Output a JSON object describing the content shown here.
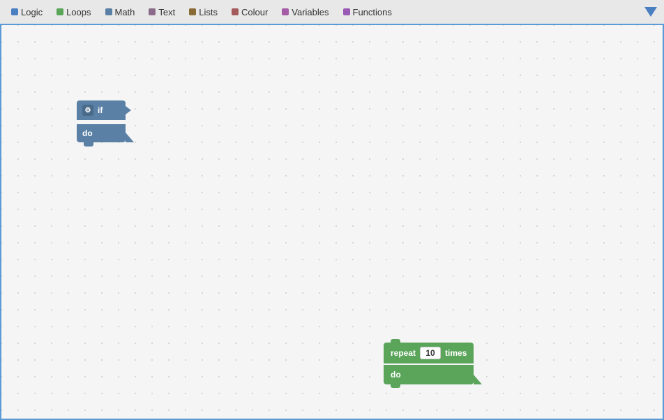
{
  "toolbar": {
    "tabs": [
      {
        "id": "logic",
        "label": "Logic",
        "color": "#4a7fc1",
        "dot_color": "#4a7fc1"
      },
      {
        "id": "loops",
        "label": "Loops",
        "color": "#5ba55b",
        "dot_color": "#5ba55b"
      },
      {
        "id": "math",
        "label": "Math",
        "color": "#5b80a5",
        "dot_color": "#5b80a5"
      },
      {
        "id": "text",
        "label": "Text",
        "color": "#8b6b8b",
        "dot_color": "#8b6b8b"
      },
      {
        "id": "lists",
        "label": "Lists",
        "color": "#8b6b35",
        "dot_color": "#8b6b35"
      },
      {
        "id": "colour",
        "label": "Colour",
        "color": "#a55b5b",
        "dot_color": "#a55b5b"
      },
      {
        "id": "variables",
        "label": "Variables",
        "color": "#a55ba5",
        "dot_color": "#a55ba5"
      },
      {
        "id": "functions",
        "label": "Functions",
        "color": "#9b59b6",
        "dot_color": "#9b59b6"
      }
    ]
  },
  "if_block": {
    "if_label": "if",
    "do_label": "do"
  },
  "repeat_block": {
    "repeat_label": "repeat",
    "times_label": "times",
    "do_label": "do",
    "value": "10"
  }
}
